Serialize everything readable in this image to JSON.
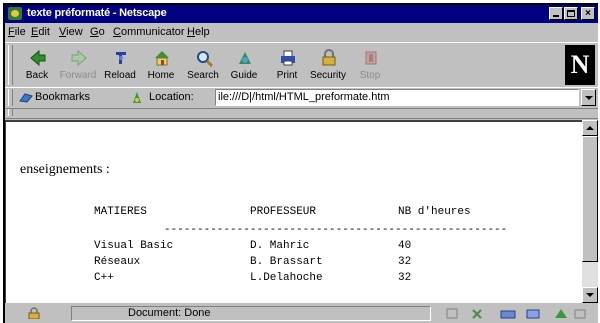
{
  "window": {
    "title": "texte préformaté - Netscape"
  },
  "menu": [
    {
      "acc": "F",
      "rest": "ile"
    },
    {
      "acc": "E",
      "rest": "dit"
    },
    {
      "acc": "V",
      "rest": "iew"
    },
    {
      "acc": "G",
      "rest": "o"
    },
    {
      "acc": "C",
      "rest": "ommunicator"
    },
    {
      "acc": "H",
      "rest": "elp"
    }
  ],
  "toolbar": {
    "back": "Back",
    "forward": "Forward",
    "reload": "Reload",
    "home": "Home",
    "search": "Search",
    "guide": "Guide",
    "print": "Print",
    "security": "Security",
    "stop": "Stop",
    "logo": "N"
  },
  "locationbar": {
    "bookmarks": "Bookmarks",
    "location_label": "Location:",
    "url": "ile:///D|/html/HTML_preformate.htm"
  },
  "content": {
    "heading": "enseignements :",
    "headers": {
      "matieres": "MATIERES",
      "professeur": "PROFESSEUR",
      "heures": "NB d'heures"
    },
    "rule": "----------------------------------------------------",
    "rows": [
      {
        "matiere": "Visual Basic",
        "professeur": "D. Mahric",
        "heures": "40"
      },
      {
        "matiere": "Réseaux",
        "professeur": "B. Brassart",
        "heures": "32"
      },
      {
        "matiere": "C++",
        "professeur": "L.Delahoche",
        "heures": "32"
      }
    ]
  },
  "status": {
    "text": "Document: Done"
  },
  "colors": {
    "titlebar": "#000080",
    "chrome": "#c0c0c0",
    "content_bg": "#ffffff"
  }
}
